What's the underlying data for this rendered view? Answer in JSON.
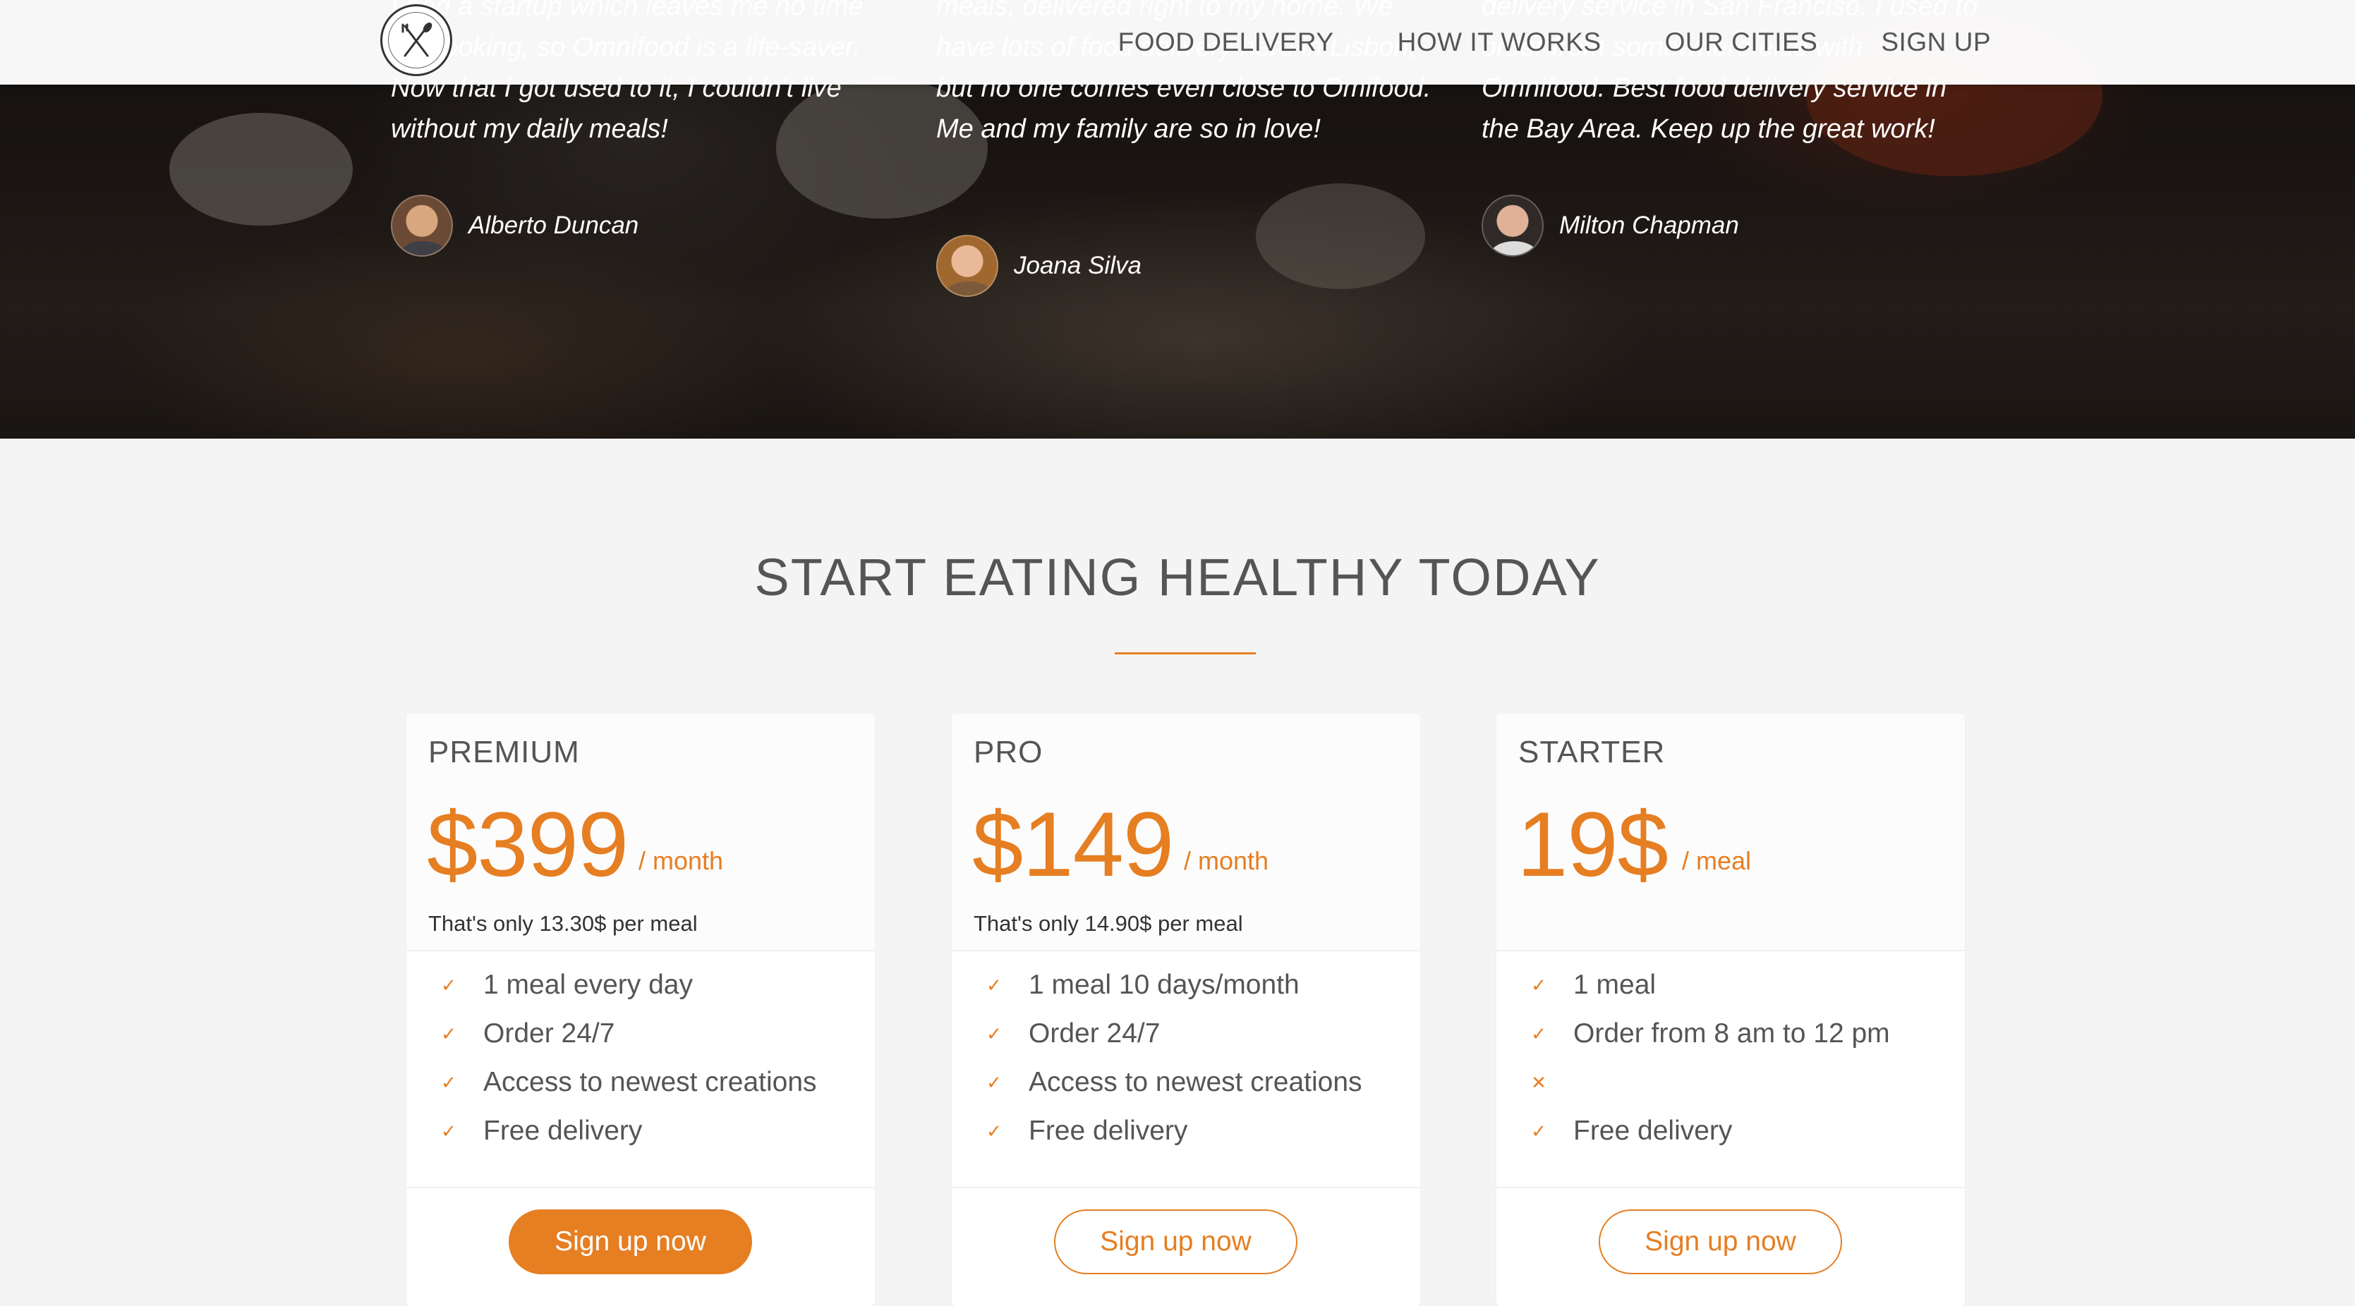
{
  "nav": {
    "logo_icon": "fork-knife-logo-icon",
    "links": [
      "FOOD DELIVERY",
      "HOW IT WORKS",
      "OUR CITIES",
      "SIGN UP"
    ]
  },
  "testimonials": [
    {
      "quote": "I had a startup which leaves me no time for cooking, so Omnifood is a life-saver. Now that I got used to it, I couldn't live without my daily meals!",
      "author": "Alberto Duncan"
    },
    {
      "quote": "meals, delivered right to my home. We have lots of food delivery here in Lisbon, but no one comes even close to Omifood. Me and my family are so in love!",
      "author": "Joana Silva"
    },
    {
      "quote": "delivery service in San Franciso. I used to order from somewhere else with Omnifood. Best food delivery service in the Bay Area. Keep up the great work!",
      "author": "Milton Chapman"
    }
  ],
  "plans_section": {
    "title": "START EATING HEALTHY TODAY",
    "accent_color": "#e67e22"
  },
  "plans": [
    {
      "name": "PREMIUM",
      "price": "$399",
      "per": "/ month",
      "note": "That's only 13.30$ per meal",
      "features": [
        {
          "icon": "checkmark-icon",
          "text": "1 meal every day"
        },
        {
          "icon": "checkmark-icon",
          "text": "Order 24/7"
        },
        {
          "icon": "checkmark-icon",
          "text": "Access to newest creations"
        },
        {
          "icon": "checkmark-icon",
          "text": "Free delivery"
        }
      ],
      "button": "Sign up now",
      "button_style": "full"
    },
    {
      "name": "PRO",
      "price": "$149",
      "per": "/ month",
      "note": "That's only 14.90$ per meal",
      "features": [
        {
          "icon": "checkmark-icon",
          "text": "1 meal 10 days/month"
        },
        {
          "icon": "checkmark-icon",
          "text": "Order 24/7"
        },
        {
          "icon": "checkmark-icon",
          "text": "Access to newest creations"
        },
        {
          "icon": "checkmark-icon",
          "text": "Free delivery"
        }
      ],
      "button": "Sign up now",
      "button_style": "ghost"
    },
    {
      "name": "STARTER",
      "price": "19$",
      "per": "/ meal",
      "note": "",
      "features": [
        {
          "icon": "checkmark-icon",
          "text": "1 meal"
        },
        {
          "icon": "checkmark-icon",
          "text": "Order from 8 am to 12 pm"
        },
        {
          "icon": "close-icon",
          "text": ""
        },
        {
          "icon": "checkmark-icon",
          "text": "Free delivery"
        }
      ],
      "button": "Sign up now",
      "button_style": "ghost"
    }
  ]
}
